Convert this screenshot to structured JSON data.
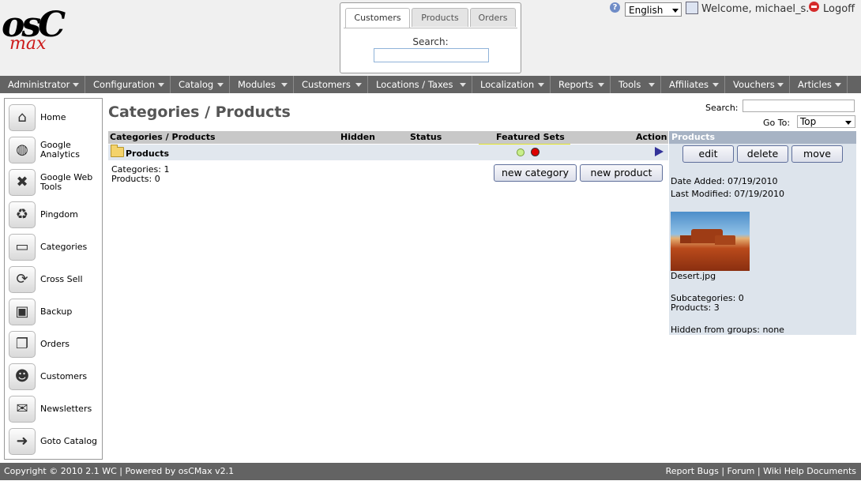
{
  "header": {
    "logo": {
      "text_main": "osC",
      "text_sub": "max"
    },
    "quick_search": {
      "tabs": [
        "Customers",
        "Products",
        "Orders"
      ],
      "active_tab": "Customers",
      "search_label": "Search:",
      "search_value": ""
    },
    "language": "English",
    "welcome": "Welcome, michael_s.",
    "logoff": "Logoff"
  },
  "menu": [
    "Administrator",
    "Configuration",
    "Catalog",
    "Modules",
    "Customers",
    "Locations / Taxes",
    "Localization",
    "Reports",
    "Tools",
    "Affiliates",
    "Vouchers",
    "Articles"
  ],
  "sidebar": {
    "items": [
      {
        "label": "Home",
        "icon": "home-icon"
      },
      {
        "label": "Google Analytics",
        "icon": "globe-icon"
      },
      {
        "label": "Google Web Tools",
        "icon": "tools-icon"
      },
      {
        "label": "Pingdom",
        "icon": "recycle-icon"
      },
      {
        "label": "Categories",
        "icon": "folder-icon"
      },
      {
        "label": "Cross Sell",
        "icon": "refresh-icon"
      },
      {
        "label": "Backup",
        "icon": "floppy-icon"
      },
      {
        "label": "Orders",
        "icon": "documents-icon"
      },
      {
        "label": "Customers",
        "icon": "people-icon"
      },
      {
        "label": "Newsletters",
        "icon": "envelope-icon"
      },
      {
        "label": "Goto Catalog",
        "icon": "arrow-right-icon"
      }
    ]
  },
  "main": {
    "title": "Categories / Products",
    "search_label": "Search:",
    "search_value": "",
    "goto_label": "Go To:",
    "goto_value": "Top",
    "columns": [
      "Categories / Products",
      "Hidden",
      "Status",
      "Featured Sets",
      "Action"
    ],
    "row": {
      "name": "Products"
    },
    "counts": {
      "categories": "Categories: 1",
      "products": "Products: 0"
    },
    "buttons": {
      "new_category": "new category",
      "new_product": "new product"
    }
  },
  "info_panel": {
    "title": "Products",
    "buttons": {
      "edit": "edit",
      "delete": "delete",
      "move": "move"
    },
    "date_added": "Date Added: 07/19/2010",
    "last_modified": "Last Modified: 07/19/2010",
    "image_name": "Desert.jpg",
    "subcategories": "Subcategories: 0",
    "products": "Products: 3",
    "hidden_groups": "Hidden from groups: none"
  },
  "footer": {
    "left": "Copyright © 2010 2.1 WC | Powered by osCMax v2.1",
    "right": "Report Bugs | Forum | Wiki Help Documents"
  },
  "colors": {
    "menu_bg": "#636363",
    "highlight": "#e6e62a",
    "panel_bg": "#dde4ec",
    "panel_title_bg": "#a7b3c4",
    "status_red": "#dd0000",
    "status_green": "#c9ef8c"
  }
}
